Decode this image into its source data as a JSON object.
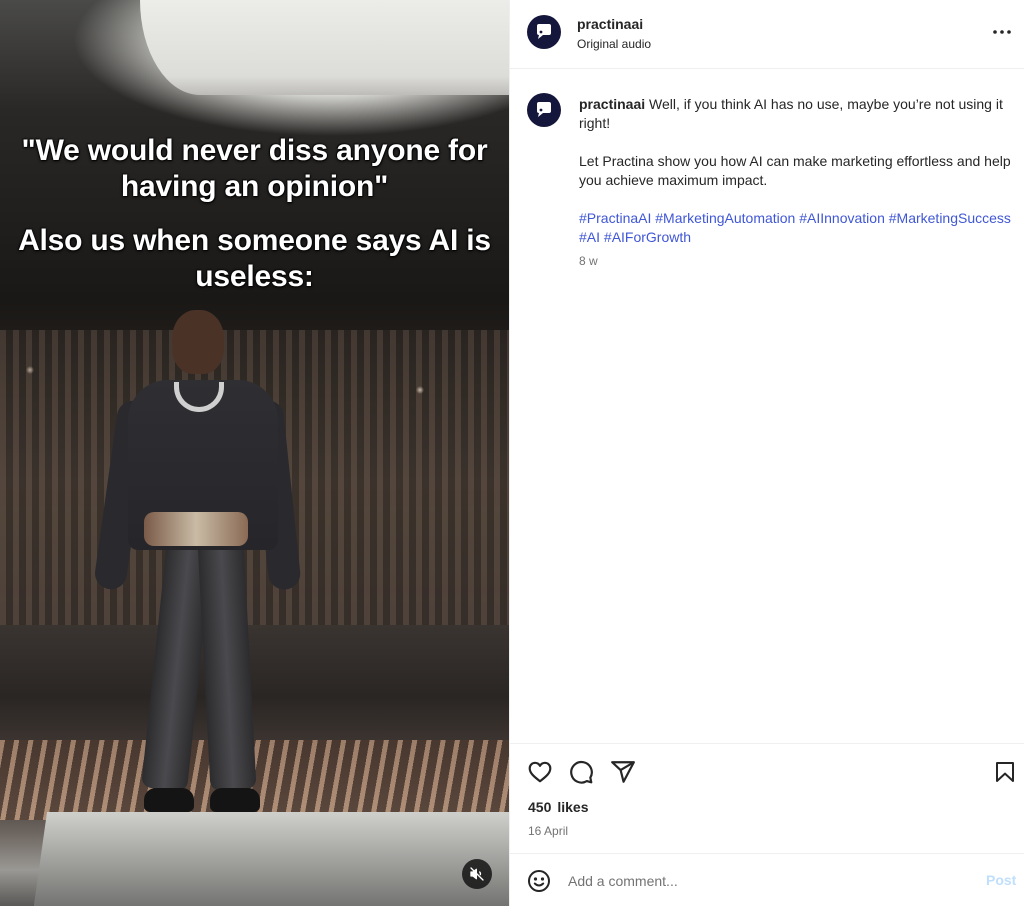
{
  "media": {
    "caption_line1": "\"We would never diss anyone for having an opinion\"",
    "caption_line2": "Also us when someone says AI is useless:",
    "mute_icon": "speaker-muted-icon"
  },
  "header": {
    "username": "practinaai",
    "subtitle": "Original audio",
    "more_icon": "more-horizontal-icon"
  },
  "comment": {
    "username": "practinaai",
    "text_line1": "Well, if you think AI has no use, maybe you’re not using it right!",
    "text_line2": "Let Practina show you how AI can make marketing effortless and help you achieve maximum impact.",
    "hashtags": [
      "#PractinaAI",
      "#MarketingAutomation",
      "#AIInnovation",
      "#MarketingSuccess",
      "#AI",
      "#AIForGrowth"
    ],
    "time": "8 w"
  },
  "actions": {
    "like_icon": "heart-icon",
    "comment_icon": "comment-icon",
    "share_icon": "paper-plane-icon",
    "save_icon": "bookmark-icon",
    "likes_count": "450",
    "likes_label": "likes",
    "date": "16 April"
  },
  "add_comment": {
    "placeholder": "Add a comment...",
    "post_label": "Post",
    "emoji_icon": "emoji-icon"
  },
  "colors": {
    "avatar_bg": "#14163c",
    "link": "#4057d6",
    "post_disabled": "#c0dffd"
  }
}
